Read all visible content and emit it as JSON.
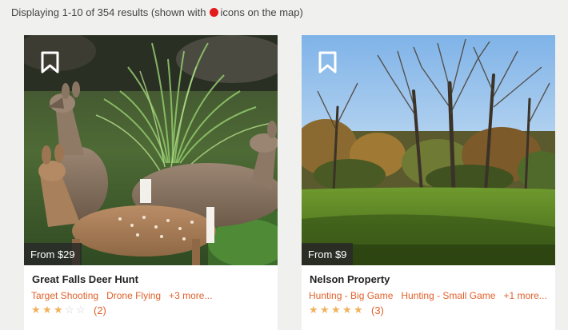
{
  "results": {
    "prefix": "Displaying 1-10 of 354 results (shown with",
    "suffix": "icons on the map)",
    "marker_color": "#e21b1b"
  },
  "listings": [
    {
      "title": "Great Falls Deer Hunt",
      "price": "From $29",
      "tags": [
        "Target Shooting",
        "Drone Flying",
        "+3 more..."
      ],
      "rating": 3,
      "rating_max": 5,
      "review_count": "(2)",
      "image": "deer-photo"
    },
    {
      "title": "Nelson Property",
      "price": "From $9",
      "tags": [
        "Hunting - Big Game",
        "Hunting - Small Game",
        "+1 more..."
      ],
      "rating": 5,
      "rating_max": 5,
      "review_count": "(3)",
      "image": "meadow-trees-photo"
    }
  ],
  "colors": {
    "accent": "#e0612b",
    "star": "#f2b15a"
  }
}
